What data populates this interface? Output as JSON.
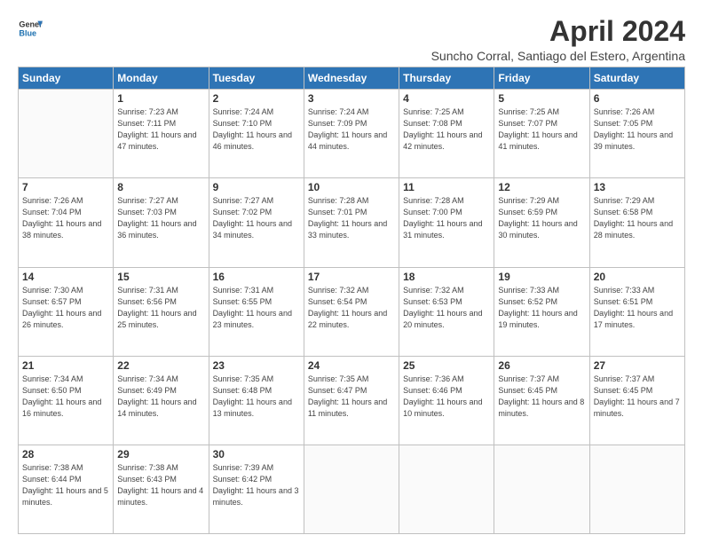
{
  "logo": {
    "line1": "General",
    "line2": "Blue"
  },
  "title": "April 2024",
  "subtitle": "Suncho Corral, Santiago del Estero, Argentina",
  "headers": [
    "Sunday",
    "Monday",
    "Tuesday",
    "Wednesday",
    "Thursday",
    "Friday",
    "Saturday"
  ],
  "weeks": [
    [
      {
        "day": "",
        "sunrise": "",
        "sunset": "",
        "daylight": ""
      },
      {
        "day": "1",
        "sunrise": "7:23 AM",
        "sunset": "7:11 PM",
        "daylight": "11 hours and 47 minutes."
      },
      {
        "day": "2",
        "sunrise": "7:24 AM",
        "sunset": "7:10 PM",
        "daylight": "11 hours and 46 minutes."
      },
      {
        "day": "3",
        "sunrise": "7:24 AM",
        "sunset": "7:09 PM",
        "daylight": "11 hours and 44 minutes."
      },
      {
        "day": "4",
        "sunrise": "7:25 AM",
        "sunset": "7:08 PM",
        "daylight": "11 hours and 42 minutes."
      },
      {
        "day": "5",
        "sunrise": "7:25 AM",
        "sunset": "7:07 PM",
        "daylight": "11 hours and 41 minutes."
      },
      {
        "day": "6",
        "sunrise": "7:26 AM",
        "sunset": "7:05 PM",
        "daylight": "11 hours and 39 minutes."
      }
    ],
    [
      {
        "day": "7",
        "sunrise": "7:26 AM",
        "sunset": "7:04 PM",
        "daylight": "11 hours and 38 minutes."
      },
      {
        "day": "8",
        "sunrise": "7:27 AM",
        "sunset": "7:03 PM",
        "daylight": "11 hours and 36 minutes."
      },
      {
        "day": "9",
        "sunrise": "7:27 AM",
        "sunset": "7:02 PM",
        "daylight": "11 hours and 34 minutes."
      },
      {
        "day": "10",
        "sunrise": "7:28 AM",
        "sunset": "7:01 PM",
        "daylight": "11 hours and 33 minutes."
      },
      {
        "day": "11",
        "sunrise": "7:28 AM",
        "sunset": "7:00 PM",
        "daylight": "11 hours and 31 minutes."
      },
      {
        "day": "12",
        "sunrise": "7:29 AM",
        "sunset": "6:59 PM",
        "daylight": "11 hours and 30 minutes."
      },
      {
        "day": "13",
        "sunrise": "7:29 AM",
        "sunset": "6:58 PM",
        "daylight": "11 hours and 28 minutes."
      }
    ],
    [
      {
        "day": "14",
        "sunrise": "7:30 AM",
        "sunset": "6:57 PM",
        "daylight": "11 hours and 26 minutes."
      },
      {
        "day": "15",
        "sunrise": "7:31 AM",
        "sunset": "6:56 PM",
        "daylight": "11 hours and 25 minutes."
      },
      {
        "day": "16",
        "sunrise": "7:31 AM",
        "sunset": "6:55 PM",
        "daylight": "11 hours and 23 minutes."
      },
      {
        "day": "17",
        "sunrise": "7:32 AM",
        "sunset": "6:54 PM",
        "daylight": "11 hours and 22 minutes."
      },
      {
        "day": "18",
        "sunrise": "7:32 AM",
        "sunset": "6:53 PM",
        "daylight": "11 hours and 20 minutes."
      },
      {
        "day": "19",
        "sunrise": "7:33 AM",
        "sunset": "6:52 PM",
        "daylight": "11 hours and 19 minutes."
      },
      {
        "day": "20",
        "sunrise": "7:33 AM",
        "sunset": "6:51 PM",
        "daylight": "11 hours and 17 minutes."
      }
    ],
    [
      {
        "day": "21",
        "sunrise": "7:34 AM",
        "sunset": "6:50 PM",
        "daylight": "11 hours and 16 minutes."
      },
      {
        "day": "22",
        "sunrise": "7:34 AM",
        "sunset": "6:49 PM",
        "daylight": "11 hours and 14 minutes."
      },
      {
        "day": "23",
        "sunrise": "7:35 AM",
        "sunset": "6:48 PM",
        "daylight": "11 hours and 13 minutes."
      },
      {
        "day": "24",
        "sunrise": "7:35 AM",
        "sunset": "6:47 PM",
        "daylight": "11 hours and 11 minutes."
      },
      {
        "day": "25",
        "sunrise": "7:36 AM",
        "sunset": "6:46 PM",
        "daylight": "11 hours and 10 minutes."
      },
      {
        "day": "26",
        "sunrise": "7:37 AM",
        "sunset": "6:45 PM",
        "daylight": "11 hours and 8 minutes."
      },
      {
        "day": "27",
        "sunrise": "7:37 AM",
        "sunset": "6:45 PM",
        "daylight": "11 hours and 7 minutes."
      }
    ],
    [
      {
        "day": "28",
        "sunrise": "7:38 AM",
        "sunset": "6:44 PM",
        "daylight": "11 hours and 5 minutes."
      },
      {
        "day": "29",
        "sunrise": "7:38 AM",
        "sunset": "6:43 PM",
        "daylight": "11 hours and 4 minutes."
      },
      {
        "day": "30",
        "sunrise": "7:39 AM",
        "sunset": "6:42 PM",
        "daylight": "11 hours and 3 minutes."
      },
      {
        "day": "",
        "sunrise": "",
        "sunset": "",
        "daylight": ""
      },
      {
        "day": "",
        "sunrise": "",
        "sunset": "",
        "daylight": ""
      },
      {
        "day": "",
        "sunrise": "",
        "sunset": "",
        "daylight": ""
      },
      {
        "day": "",
        "sunrise": "",
        "sunset": "",
        "daylight": ""
      }
    ]
  ]
}
